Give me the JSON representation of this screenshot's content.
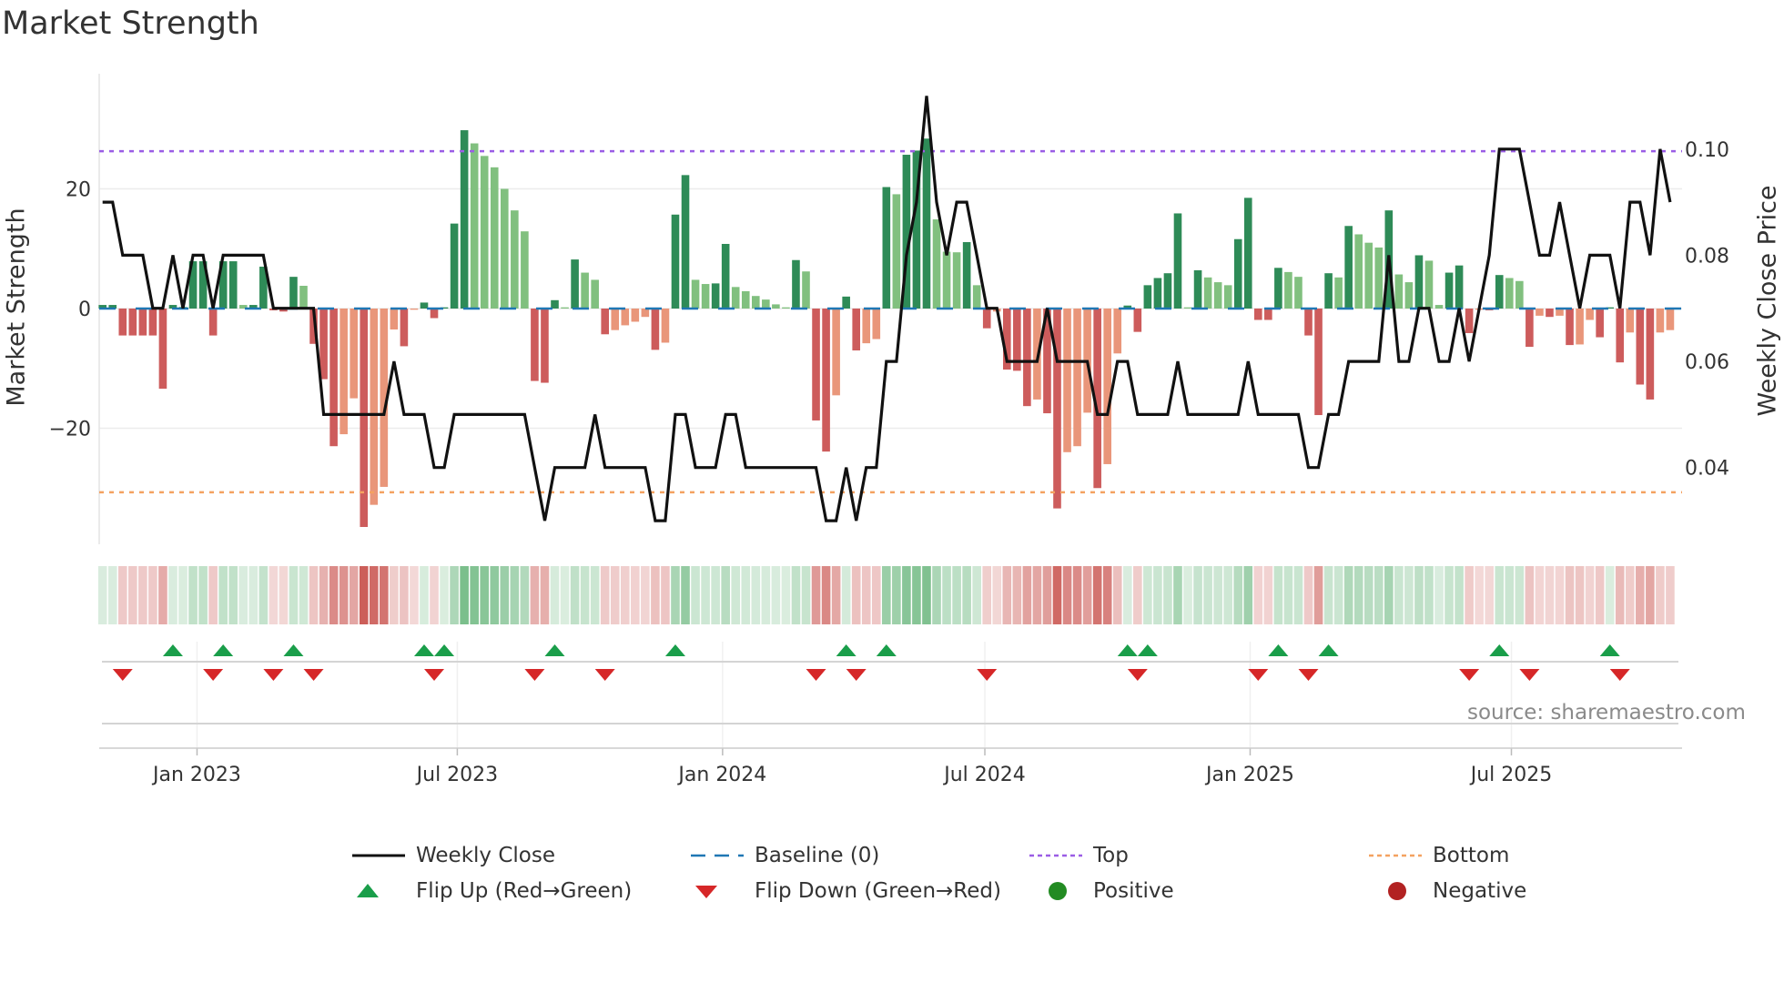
{
  "title": "Market Strength",
  "source": "source: sharemaestro.com",
  "chart_data": {
    "type": "bar",
    "title": "Market Strength",
    "ylabel": "Market Strength",
    "y2label": "Weekly Close Price",
    "ylim": [
      -39.3,
      39.3
    ],
    "y_ticks": [
      {
        "value": 20,
        "label": "20"
      },
      {
        "value": 0,
        "label": "0"
      },
      {
        "value": -20,
        "label": "−20"
      }
    ],
    "y2_ticks": [
      {
        "value": 0.1,
        "label": "0.10"
      },
      {
        "value": 0.08,
        "label": "0.08"
      },
      {
        "value": 0.06,
        "label": "0.06"
      },
      {
        "value": 0.04,
        "label": "0.04"
      }
    ],
    "x_ticks": [
      {
        "label": "Jan 2023",
        "week": 9.4
      },
      {
        "label": "Jul 2023",
        "week": 35.3
      },
      {
        "label": "Jan 2024",
        "week": 61.7
      },
      {
        "label": "Jul 2024",
        "week": 87.8
      },
      {
        "label": "Jan 2025",
        "week": 114.2
      },
      {
        "label": "Jul 2025",
        "week": 140.2
      }
    ],
    "top_level": 26.3,
    "bottom_level": -30.7,
    "baseline": 0,
    "strength": [
      0.6,
      0.6,
      -4.5,
      -4.5,
      -4.5,
      -4.5,
      -13.4,
      0.6,
      0.3,
      7.9,
      7.9,
      -4.5,
      7.9,
      7.9,
      0.6,
      0.6,
      7.0,
      -0.3,
      -0.5,
      5.3,
      3.8,
      -5.9,
      -11.8,
      -23.0,
      -21.0,
      -15.0,
      -36.5,
      -32.8,
      -29.8,
      -3.5,
      -6.3,
      -0.2,
      1.0,
      -1.6,
      0.2,
      14.2,
      29.8,
      27.6,
      25.5,
      23.6,
      20.0,
      16.4,
      12.9,
      -12.1,
      -12.4,
      1.4,
      0.2,
      8.2,
      6.0,
      4.8,
      -4.3,
      -3.6,
      -2.8,
      -2.2,
      -1.4,
      -6.9,
      -5.7,
      15.7,
      22.3,
      4.8,
      4.1,
      4.2,
      10.8,
      3.6,
      2.9,
      2.1,
      1.5,
      0.7,
      0.2,
      8.1,
      6.2,
      -18.7,
      -23.9,
      -14.5,
      2.0,
      -7.0,
      -5.8,
      -5.1,
      20.3,
      19.1,
      25.7,
      26.4,
      28.4,
      14.9,
      9.5,
      9.4,
      11.1,
      3.9,
      -3.3,
      -0.5,
      -10.2,
      -10.4,
      -16.3,
      -15.2,
      -17.5,
      -33.4,
      -24.0,
      -23.0,
      -17.4,
      -30.0,
      -26.0,
      -7.5,
      0.5,
      -3.9,
      3.9,
      5.1,
      5.9,
      15.9,
      0.2,
      6.4,
      5.2,
      4.4,
      3.9,
      11.6,
      18.5,
      -1.9,
      -1.9,
      6.8,
      6.1,
      5.3,
      -4.5,
      -17.8,
      5.9,
      5.2,
      13.8,
      12.4,
      11.0,
      10.2,
      16.4,
      5.7,
      4.4,
      8.9,
      8.0,
      0.6,
      6.0,
      7.2,
      -4.1,
      -0.2,
      -0.3,
      5.6,
      5.1,
      4.6,
      -6.4,
      -1.2,
      -1.4,
      -1.2,
      -6.1,
      -6.0,
      -1.9,
      -4.8,
      0.2,
      -9.0,
      -4.0,
      -12.7,
      -15.2,
      -4.0,
      -3.6
    ],
    "weekly_close": [
      0.09,
      0.09,
      0.08,
      0.08,
      0.08,
      0.07,
      0.07,
      0.08,
      0.07,
      0.08,
      0.08,
      0.07,
      0.08,
      0.08,
      0.08,
      0.08,
      0.08,
      0.07,
      0.07,
      0.07,
      0.07,
      0.07,
      0.05,
      0.05,
      0.05,
      0.05,
      0.05,
      0.05,
      0.05,
      0.06,
      0.05,
      0.05,
      0.05,
      0.04,
      0.04,
      0.05,
      0.05,
      0.05,
      0.05,
      0.05,
      0.05,
      0.05,
      0.05,
      0.04,
      0.03,
      0.04,
      0.04,
      0.04,
      0.04,
      0.05,
      0.04,
      0.04,
      0.04,
      0.04,
      0.04,
      0.03,
      0.03,
      0.05,
      0.05,
      0.04,
      0.04,
      0.04,
      0.05,
      0.05,
      0.04,
      0.04,
      0.04,
      0.04,
      0.04,
      0.04,
      0.04,
      0.04,
      0.03,
      0.03,
      0.04,
      0.03,
      0.04,
      0.04,
      0.06,
      0.06,
      0.08,
      0.09,
      0.11,
      0.09,
      0.08,
      0.09,
      0.09,
      0.08,
      0.07,
      0.07,
      0.06,
      0.06,
      0.06,
      0.06,
      0.07,
      0.06,
      0.06,
      0.06,
      0.06,
      0.05,
      0.05,
      0.06,
      0.06,
      0.05,
      0.05,
      0.05,
      0.05,
      0.06,
      0.05,
      0.05,
      0.05,
      0.05,
      0.05,
      0.05,
      0.06,
      0.05,
      0.05,
      0.05,
      0.05,
      0.05,
      0.04,
      0.04,
      0.05,
      0.05,
      0.06,
      0.06,
      0.06,
      0.06,
      0.08,
      0.06,
      0.06,
      0.07,
      0.07,
      0.06,
      0.06,
      0.07,
      0.06,
      0.07,
      0.08,
      0.1,
      0.1,
      0.1,
      0.09,
      0.08,
      0.08,
      0.09,
      0.08,
      0.07,
      0.08,
      0.08,
      0.08,
      0.07,
      0.09,
      0.09,
      0.08,
      0.1,
      0.09
    ],
    "flip_up_weeks": [
      8,
      13,
      20,
      33,
      35,
      46,
      58,
      75,
      79,
      103,
      105,
      118,
      123,
      140,
      151
    ],
    "flip_down_weeks": [
      3,
      12,
      18,
      22,
      34,
      44,
      51,
      72,
      76,
      89,
      104,
      116,
      121,
      137,
      143,
      152
    ],
    "colors": {
      "pos_rising": "#2e8b57",
      "pos_falling": "#81c07f",
      "neg_falling": "#cd5c5c",
      "neg_rising": "#e9967a",
      "line": "#111111",
      "baseline": "#1f77b4",
      "top": "#9b5de5",
      "bottom": "#f4a261",
      "flip_up": "#1a9e4a",
      "flip_down": "#d62728",
      "positive": "#228b22",
      "negative": "#b22222"
    },
    "legend": {
      "weekly_close": "Weekly Close",
      "baseline": "Baseline (0)",
      "top": "Top",
      "bottom": "Bottom",
      "flip_up": "Flip Up (Red→Green)",
      "flip_down": "Flip Down (Green→Red)",
      "positive": "Positive",
      "negative": "Negative"
    }
  }
}
